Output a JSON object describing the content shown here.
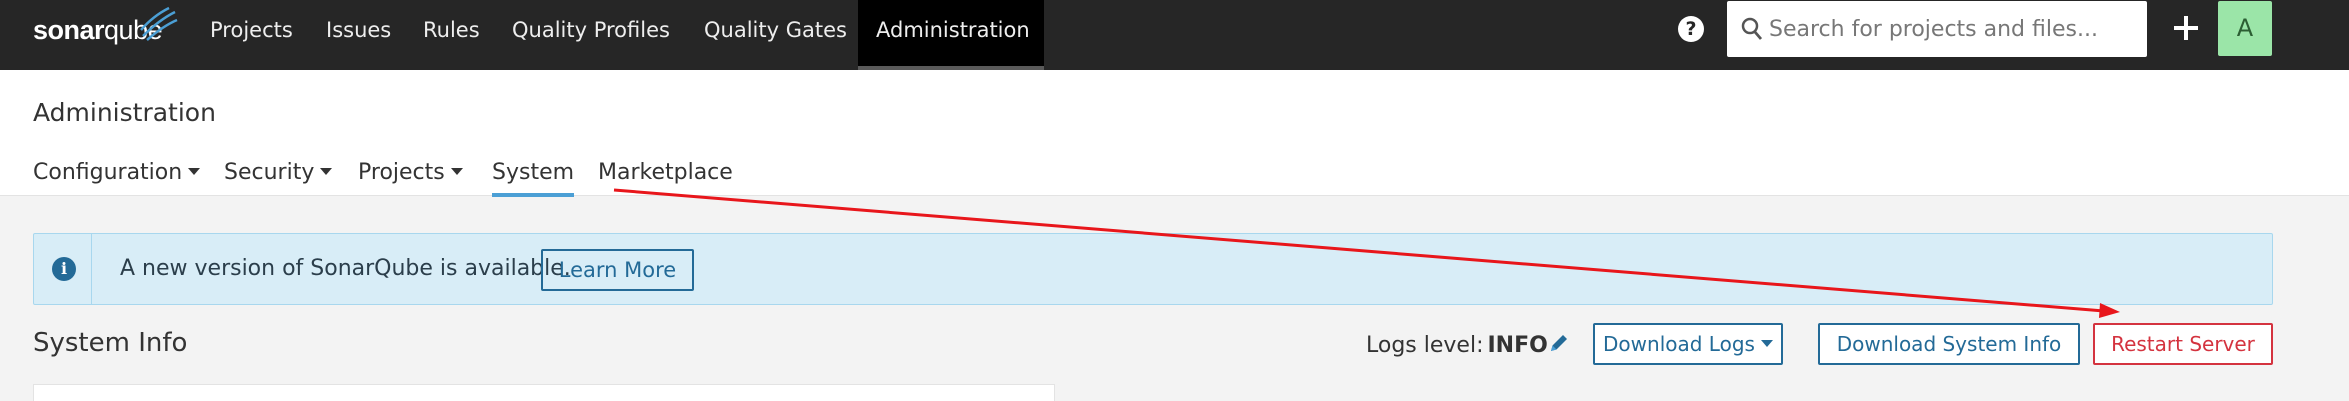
{
  "brand": {
    "logo_plain": "sonar",
    "logo_bold": "qube",
    "name": "sonarqube"
  },
  "nav": {
    "items": [
      {
        "label": "Projects"
      },
      {
        "label": "Issues"
      },
      {
        "label": "Rules"
      },
      {
        "label": "Quality Profiles"
      },
      {
        "label": "Quality Gates"
      },
      {
        "label": "Administration",
        "active": true
      }
    ],
    "help_icon": "question-circle-icon",
    "search": {
      "placeholder": "Search for projects and files...",
      "value": "",
      "icon": "search-icon"
    },
    "create_icon": "plus-icon",
    "avatar_letter": "A",
    "avatar_color": "#9be5a8"
  },
  "page": {
    "title": "Administration",
    "tabs": [
      {
        "label": "Configuration",
        "dropdown": true
      },
      {
        "label": "Security",
        "dropdown": true
      },
      {
        "label": "Projects",
        "dropdown": true
      },
      {
        "label": "System",
        "active": true
      },
      {
        "label": "Marketplace"
      }
    ]
  },
  "alert": {
    "icon": "info-icon",
    "message": "A new version of SonarQube is available.",
    "button": "Learn More"
  },
  "system": {
    "title": "System Info",
    "logs_label": "Logs level:",
    "logs_value": "INFO",
    "edit_icon": "pencil-icon",
    "download_logs": "Download Logs",
    "download_info": "Download System Info",
    "restart": "Restart Server"
  },
  "colors": {
    "topbar": "#262626",
    "accent": "#236a97",
    "danger": "#d4333f",
    "alert_bg": "#d8edf7",
    "annotation_arrow": "#e8161b"
  }
}
